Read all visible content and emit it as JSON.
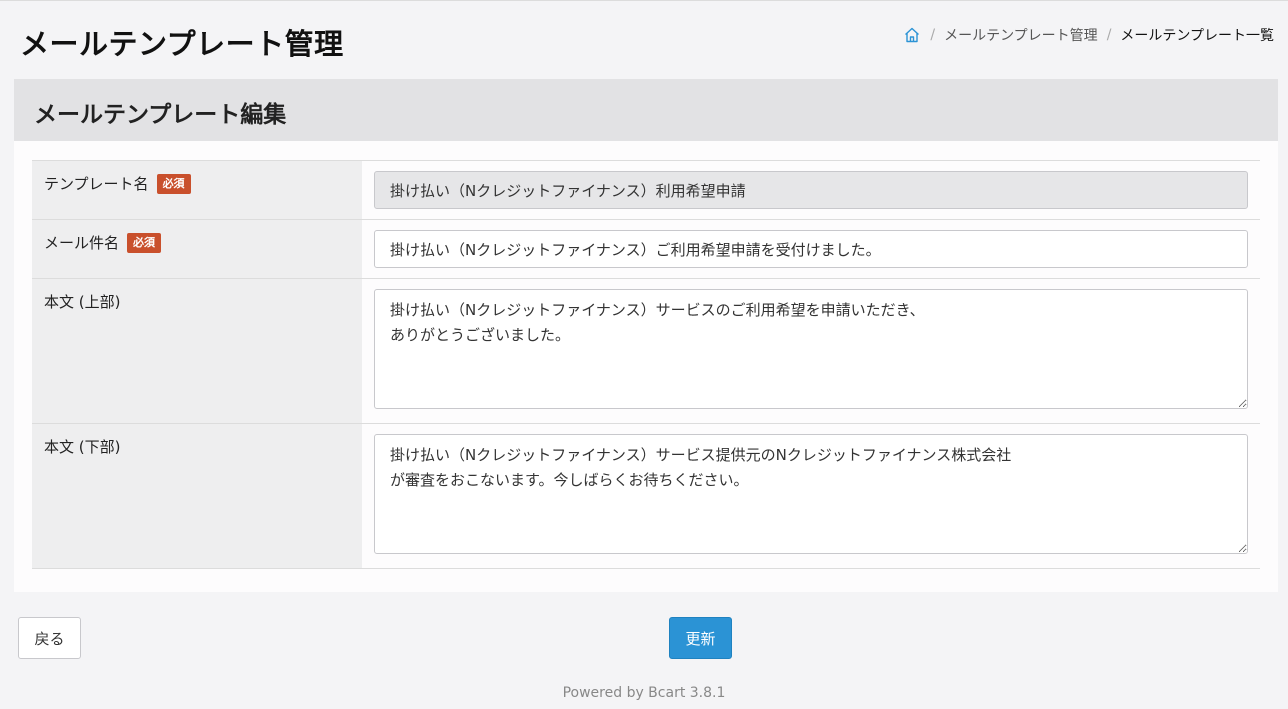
{
  "header": {
    "title": "メールテンプレート管理",
    "breadcrumb": {
      "home_icon": "home-icon",
      "separator": "/",
      "items": [
        "メールテンプレート管理",
        "メールテンプレート一覧"
      ]
    }
  },
  "card": {
    "title": "メールテンプレート編集",
    "required_badge": "必須",
    "fields": [
      {
        "label": "テンプレート名",
        "value": "掛け払い（Nクレジットファイナンス）利用希望申請"
      },
      {
        "label": "メール件名",
        "value": "掛け払い（Nクレジットファイナンス）ご利用希望申請を受付けました。"
      },
      {
        "label": "本文 (上部)",
        "value": "掛け払い（Nクレジットファイナンス）サービスのご利用希望を申請いただき、\nありがとうございました。"
      },
      {
        "label": "本文 (下部)",
        "value": "掛け払い（Nクレジットファイナンス）サービス提供元のNクレジットファイナンス株式会社\nが審査をおこないます。今しばらくお待ちください。"
      }
    ]
  },
  "actions": {
    "back_label": "戻る",
    "update_label": "更新"
  },
  "footer": {
    "text": "Powered by Bcart 3.8.1"
  },
  "colors": {
    "accent": "#2b93d5",
    "required_badge": "#c9502c",
    "header_band": "#e2e2e4"
  }
}
